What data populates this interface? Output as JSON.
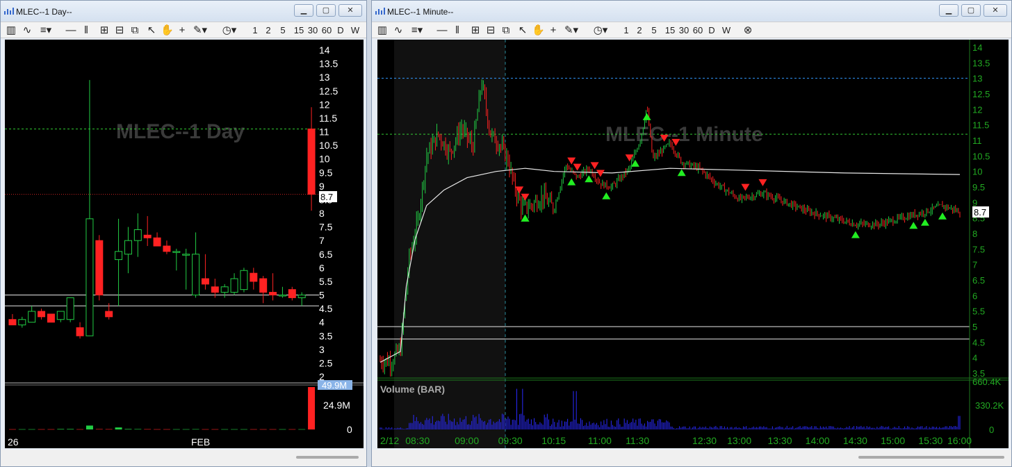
{
  "left": {
    "title": "MLEC--1 Day--",
    "watermark": "MLEC--1 Day",
    "toolbar": [
      "1",
      "2",
      "5",
      "15",
      "30",
      "60",
      "D",
      "W"
    ],
    "price_labels": [
      "14",
      "13.5",
      "13",
      "12.5",
      "12",
      "11.5",
      "11",
      "10.5",
      "10",
      "9.5",
      "9",
      "8.5",
      "8",
      "7.5",
      "7",
      "6.5",
      "6",
      "5.5",
      "5",
      "4.5",
      "4",
      "3.5",
      "3",
      "2.5",
      "2"
    ],
    "price_tag": "8.7",
    "vol_tag": "49.9M",
    "vol_labels": [
      "24.9M",
      "0"
    ],
    "x_labels": [
      "26",
      "FEB"
    ]
  },
  "right": {
    "title": "MLEC--1 Minute--",
    "watermark": "MLEC--1 Minute",
    "toolbar": [
      "1",
      "2",
      "5",
      "15",
      "30",
      "60",
      "D",
      "W"
    ],
    "price_labels": [
      "14",
      "13.5",
      "13",
      "12.5",
      "12",
      "11.5",
      "11",
      "10.5",
      "10",
      "9.5",
      "9",
      "8.5",
      "8",
      "7.5",
      "7",
      "6.5",
      "6",
      "5.5",
      "5",
      "4.5",
      "4",
      "3.5"
    ],
    "price_tag": "8.7",
    "volume_label": "Volume (BAR)",
    "vol_labels": [
      "660.4K",
      "330.2K",
      "0"
    ],
    "x_labels": [
      "2/12",
      "08:30",
      "09:00",
      "09:30",
      "10:15",
      "11:00",
      "11:30",
      "12:30",
      "13:00",
      "13:30",
      "14:00",
      "14:30",
      "15:00",
      "15:30",
      "16:00"
    ]
  },
  "colors": {
    "up": "#22cc44",
    "down": "#ff2222",
    "axis_green": "#22aa22",
    "line_white": "#e8e8e8",
    "dash_green": "#33cc33",
    "dash_blue": "#3399ff"
  },
  "chart_data": [
    {
      "type": "candlestick",
      "title": "MLEC--1 Day",
      "ylim": [
        2,
        14
      ],
      "series": [
        {
          "name": "MLEC",
          "values": [
            {
              "o": 4.1,
              "h": 4.3,
              "l": 3.9,
              "c": 3.9
            },
            {
              "o": 3.9,
              "h": 4.2,
              "l": 3.8,
              "c": 4.1
            },
            {
              "o": 4.0,
              "h": 4.6,
              "l": 4.0,
              "c": 4.4
            },
            {
              "o": 4.4,
              "h": 4.5,
              "l": 4.1,
              "c": 4.2
            },
            {
              "o": 4.3,
              "h": 4.3,
              "l": 4.0,
              "c": 4.0
            },
            {
              "o": 4.1,
              "h": 4.4,
              "l": 4.0,
              "c": 4.4
            },
            {
              "o": 4.1,
              "h": 4.9,
              "l": 4.0,
              "c": 4.9
            },
            {
              "o": 3.8,
              "h": 4.0,
              "l": 3.4,
              "c": 3.5
            },
            {
              "o": 3.5,
              "h": 12.9,
              "l": 3.5,
              "c": 7.8
            },
            {
              "o": 7.0,
              "h": 7.2,
              "l": 4.8,
              "c": 5.0
            },
            {
              "o": 4.4,
              "h": 4.7,
              "l": 4.1,
              "c": 4.2
            },
            {
              "o": 6.3,
              "h": 7.8,
              "l": 4.6,
              "c": 6.6
            },
            {
              "o": 6.5,
              "h": 7.5,
              "l": 5.8,
              "c": 7.0
            },
            {
              "o": 7.0,
              "h": 8.0,
              "l": 6.4,
              "c": 7.4
            },
            {
              "o": 7.2,
              "h": 7.9,
              "l": 6.8,
              "c": 7.1
            },
            {
              "o": 7.1,
              "h": 7.3,
              "l": 6.8,
              "c": 6.8
            },
            {
              "o": 6.8,
              "h": 7.0,
              "l": 6.5,
              "c": 6.6
            },
            {
              "o": 6.6,
              "h": 6.7,
              "l": 5.9,
              "c": 6.6
            },
            {
              "o": 6.5,
              "h": 6.7,
              "l": 5.2,
              "c": 6.5
            },
            {
              "o": 5.0,
              "h": 7.3,
              "l": 4.9,
              "c": 6.5
            },
            {
              "o": 5.6,
              "h": 6.5,
              "l": 5.2,
              "c": 5.4
            },
            {
              "o": 5.3,
              "h": 5.6,
              "l": 4.9,
              "c": 5.1
            },
            {
              "o": 5.1,
              "h": 5.4,
              "l": 4.9,
              "c": 5.3
            },
            {
              "o": 5.1,
              "h": 5.8,
              "l": 5.0,
              "c": 5.6
            },
            {
              "o": 5.2,
              "h": 6.0,
              "l": 5.1,
              "c": 5.9
            },
            {
              "o": 5.8,
              "h": 6.0,
              "l": 5.2,
              "c": 5.5
            },
            {
              "o": 5.6,
              "h": 5.7,
              "l": 4.7,
              "c": 5.1
            },
            {
              "o": 5.1,
              "h": 5.8,
              "l": 4.8,
              "c": 5.0
            },
            {
              "o": 5.0,
              "h": 5.3,
              "l": 4.9,
              "c": 5.0
            },
            {
              "o": 5.2,
              "h": 5.3,
              "l": 4.8,
              "c": 4.9
            },
            {
              "o": 4.9,
              "h": 5.1,
              "l": 4.6,
              "c": 5.0
            },
            {
              "o": 11.1,
              "h": 11.9,
              "l": 8.1,
              "c": 8.7
            }
          ]
        }
      ],
      "volume": [
        0.3,
        0.3,
        0.3,
        0.3,
        0.3,
        0.6,
        0.6,
        0.3,
        4.6,
        0.5,
        0.4,
        2.4,
        0.6,
        0.5,
        0.4,
        0.3,
        0.3,
        0.3,
        0.3,
        0.4,
        0.3,
        0.3,
        0.3,
        0.3,
        0.3,
        0.3,
        0.3,
        0.3,
        0.3,
        0.3,
        0.3,
        49.9
      ],
      "vol_ylim": [
        0,
        49.9
      ],
      "hlines": [
        {
          "y": 11.1,
          "style": "dashed",
          "color": "green"
        },
        {
          "y": 8.7,
          "style": "dotted",
          "color": "red"
        },
        {
          "y": 5.0,
          "style": "solid",
          "color": "white"
        },
        {
          "y": 4.6,
          "style": "solid",
          "color": "white"
        }
      ]
    },
    {
      "type": "candlestick",
      "title": "MLEC--1 Minute",
      "ylim": [
        3.5,
        14
      ],
      "x": [
        "2/12",
        "08:30",
        "09:00",
        "09:30",
        "10:15",
        "11:00",
        "11:30",
        "12:30",
        "13:00",
        "13:30",
        "14:00",
        "14:30",
        "15:00",
        "15:30",
        "16:00"
      ],
      "price_path": [
        {
          "t": 0.0,
          "p": 3.9
        },
        {
          "t": 0.02,
          "p": 3.9
        },
        {
          "t": 0.035,
          "p": 4.3
        },
        {
          "t": 0.05,
          "p": 7.2
        },
        {
          "t": 0.065,
          "p": 8.4
        },
        {
          "t": 0.08,
          "p": 10.5
        },
        {
          "t": 0.1,
          "p": 11.2
        },
        {
          "t": 0.12,
          "p": 10.6
        },
        {
          "t": 0.14,
          "p": 11.4
        },
        {
          "t": 0.16,
          "p": 10.8
        },
        {
          "t": 0.175,
          "p": 12.9
        },
        {
          "t": 0.19,
          "p": 11.2
        },
        {
          "t": 0.205,
          "p": 10.9
        },
        {
          "t": 0.22,
          "p": 10.4
        },
        {
          "t": 0.23,
          "p": 9.6
        },
        {
          "t": 0.245,
          "p": 8.8
        },
        {
          "t": 0.26,
          "p": 8.9
        },
        {
          "t": 0.28,
          "p": 9.2
        },
        {
          "t": 0.3,
          "p": 8.8
        },
        {
          "t": 0.32,
          "p": 10.2
        },
        {
          "t": 0.34,
          "p": 9.8
        },
        {
          "t": 0.36,
          "p": 10.1
        },
        {
          "t": 0.38,
          "p": 9.6
        },
        {
          "t": 0.4,
          "p": 9.5
        },
        {
          "t": 0.43,
          "p": 10.1
        },
        {
          "t": 0.45,
          "p": 11.1
        },
        {
          "t": 0.46,
          "p": 12.1
        },
        {
          "t": 0.47,
          "p": 10.4
        },
        {
          "t": 0.5,
          "p": 10.9
        },
        {
          "t": 0.52,
          "p": 10.3
        },
        {
          "t": 0.55,
          "p": 10.1
        },
        {
          "t": 0.58,
          "p": 9.6
        },
        {
          "t": 0.62,
          "p": 9.1
        },
        {
          "t": 0.66,
          "p": 9.3
        },
        {
          "t": 0.7,
          "p": 9.0
        },
        {
          "t": 0.74,
          "p": 8.7
        },
        {
          "t": 0.78,
          "p": 8.5
        },
        {
          "t": 0.82,
          "p": 8.3
        },
        {
          "t": 0.86,
          "p": 8.3
        },
        {
          "t": 0.9,
          "p": 8.5
        },
        {
          "t": 0.94,
          "p": 8.7
        },
        {
          "t": 0.97,
          "p": 8.9
        },
        {
          "t": 1.0,
          "p": 8.7
        }
      ],
      "vwap": [
        {
          "t": 0.0,
          "p": 3.85
        },
        {
          "t": 0.035,
          "p": 4.2
        },
        {
          "t": 0.045,
          "p": 6.3
        },
        {
          "t": 0.06,
          "p": 7.8
        },
        {
          "t": 0.08,
          "p": 8.9
        },
        {
          "t": 0.11,
          "p": 9.4
        },
        {
          "t": 0.15,
          "p": 9.8
        },
        {
          "t": 0.2,
          "p": 10.0
        },
        {
          "t": 0.25,
          "p": 10.1
        },
        {
          "t": 0.3,
          "p": 10.0
        },
        {
          "t": 0.4,
          "p": 9.95
        },
        {
          "t": 0.5,
          "p": 10.1
        },
        {
          "t": 0.6,
          "p": 10.05
        },
        {
          "t": 0.8,
          "p": 9.95
        },
        {
          "t": 1.0,
          "p": 9.9
        }
      ],
      "buy_markers": [
        0.25,
        0.25,
        0.33,
        0.36,
        0.39,
        0.44,
        0.46,
        0.52,
        0.82,
        0.92,
        0.94,
        0.97
      ],
      "sell_markers": [
        0.24,
        0.25,
        0.33,
        0.34,
        0.37,
        0.38,
        0.43,
        0.49,
        0.51,
        0.63,
        0.66
      ],
      "volume_peak": 660.4,
      "hlines": [
        {
          "y": 13.0,
          "style": "dashed",
          "color": "blue"
        },
        {
          "y": 11.2,
          "style": "dashed",
          "color": "green"
        },
        {
          "y": 5.0,
          "style": "solid",
          "color": "white"
        },
        {
          "y": 4.6,
          "style": "solid",
          "color": "white"
        }
      ]
    }
  ]
}
